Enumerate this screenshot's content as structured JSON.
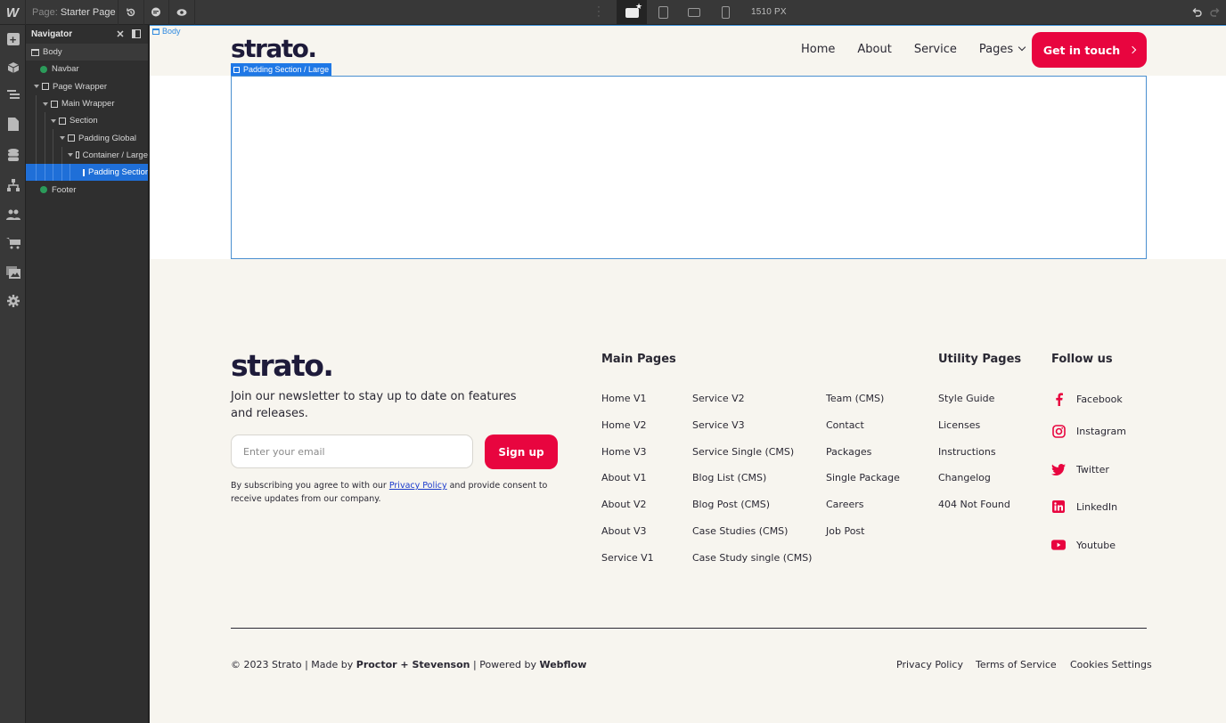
{
  "topbar": {
    "logo": "W",
    "page_prefix": "Page:",
    "page_name": "Starter Page",
    "icons": [
      "history-icon",
      "comments-icon",
      "preview-eye-icon"
    ],
    "breakpoints": [
      "desktop-base",
      "tablet",
      "mobile-landscape",
      "mobile-portrait"
    ],
    "active_breakpoint": "desktop-base",
    "width_readout": "1510 PX"
  },
  "rail": {
    "items": [
      "add-icon",
      "components-icon",
      "navigator-icon",
      "pages-icon",
      "cms-icon",
      "logic-icon",
      "users-icon",
      "ecommerce-icon",
      "assets-icon",
      "settings-icon"
    ]
  },
  "navigator": {
    "title": "Navigator",
    "tree": [
      {
        "label": "Body",
        "type": "body",
        "depth": 0
      },
      {
        "label": "Navbar",
        "type": "symbol",
        "depth": 1
      },
      {
        "label": "Page Wrapper",
        "type": "div",
        "depth": 1
      },
      {
        "label": "Main Wrapper",
        "type": "div",
        "depth": 2
      },
      {
        "label": "Section",
        "type": "div",
        "depth": 3
      },
      {
        "label": "Padding Global",
        "type": "div",
        "depth": 4
      },
      {
        "label": "Container / Large",
        "type": "div",
        "depth": 5
      },
      {
        "label": "Padding Section / Large",
        "type": "div",
        "depth": 6,
        "selected": true
      },
      {
        "label": "Footer",
        "type": "symbol",
        "depth": 1
      }
    ]
  },
  "canvas": {
    "body_tag": "Body",
    "selected_tag": "Padding Section / Large",
    "navbar": {
      "logo": "strato.",
      "links": [
        "Home",
        "About",
        "Service",
        "Pages"
      ],
      "cta": "Get in touch"
    },
    "footer": {
      "logo": "strato.",
      "newsletter_text": "Join our newsletter to stay up to date on features and releases.",
      "email_placeholder": "Enter your email",
      "signup_label": "Sign up",
      "consent_before": "By subscribing you agree to with our ",
      "consent_link": "Privacy Policy",
      "consent_after": " and provide consent to receive updates from our company.",
      "main_pages_title": "Main Pages",
      "main_pages_col1": [
        "Home V1",
        "Home V2",
        "Home V3",
        "About V1",
        "About V2",
        "About V3",
        "Service V1"
      ],
      "main_pages_col2": [
        "Service V2",
        "Service V3",
        "Service Single (CMS)",
        "Blog List (CMS)",
        "Blog Post (CMS)",
        "Case Studies (CMS)",
        "Case Study single (CMS)"
      ],
      "main_pages_col3": [
        "Team (CMS)",
        "Contact",
        "Packages",
        "Single Package",
        "Careers",
        "Job Post"
      ],
      "utility_title": "Utility Pages",
      "utility_pages": [
        "Style Guide",
        "Licenses",
        "Instructions",
        "Changelog",
        "404 Not Found"
      ],
      "follow_title": "Follow us",
      "social": [
        {
          "label": "Facebook",
          "icon": "facebook-icon"
        },
        {
          "label": "Instagram",
          "icon": "instagram-icon"
        },
        {
          "label": "Twitter",
          "icon": "twitter-icon"
        },
        {
          "label": "LinkedIn",
          "icon": "linkedin-icon"
        },
        {
          "label": "Youtube",
          "icon": "youtube-icon"
        }
      ],
      "copyright_pre": "© 2023 Strato | Made by ",
      "copyright_maker": "Proctor + Stevenson",
      "copyright_mid": " | Powered by ",
      "copyright_platform": "Webflow",
      "legal_links": [
        "Privacy Policy",
        "Terms of Service",
        "Cookies Settings"
      ]
    }
  },
  "colors": {
    "accent": "#e8053f",
    "brand_dark": "#1e1b3a",
    "selection_blue": "#1f78e6",
    "canvas_bg": "#f7f5ef"
  }
}
